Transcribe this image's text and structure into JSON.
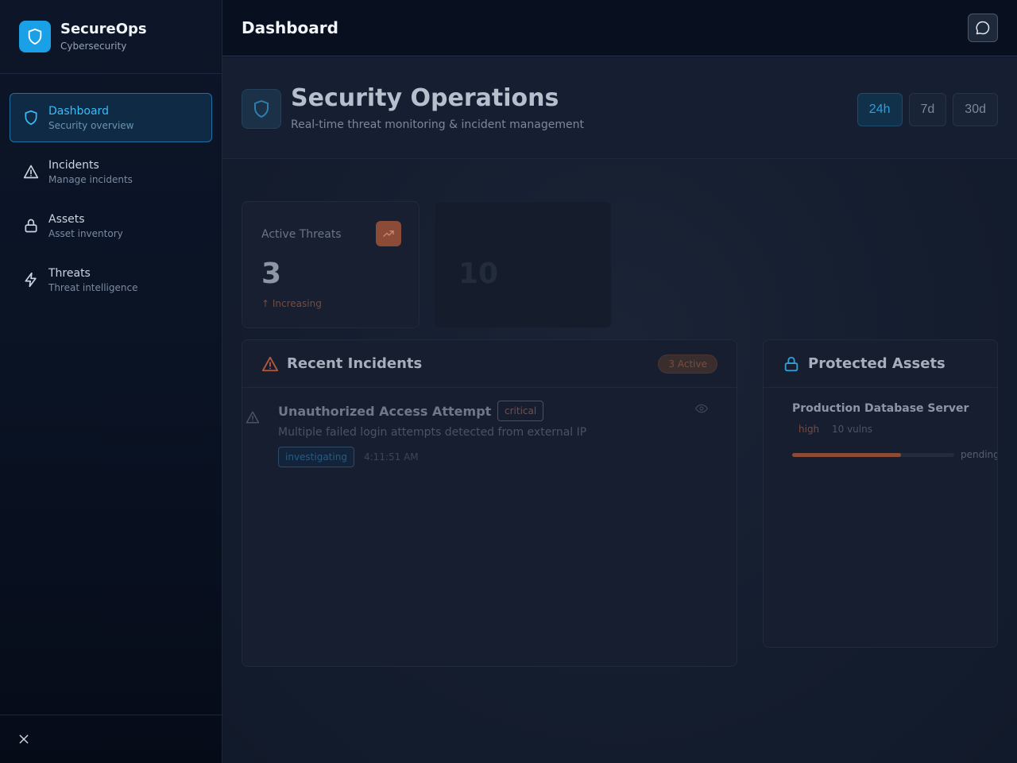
{
  "brand": {
    "name": "SecureOps",
    "subtitle": "Cybersecurity",
    "accent": "#1aa0e6"
  },
  "sidebar": {
    "items": [
      {
        "label": "Dashboard",
        "description": "Security overview",
        "icon": "shield-icon",
        "active": true
      },
      {
        "label": "Incidents",
        "description": "Manage incidents",
        "icon": "alert-triangle-icon",
        "active": false
      },
      {
        "label": "Assets",
        "description": "Asset inventory",
        "icon": "lock-icon",
        "active": false
      },
      {
        "label": "Threats",
        "description": "Threat intelligence",
        "icon": "zap-icon",
        "active": false
      }
    ],
    "footer_icon": "close-icon"
  },
  "topbar": {
    "title": "Dashboard",
    "chat_icon": "chat-icon"
  },
  "main": {
    "header": {
      "title": "Security Operations",
      "subtitle": "Real-time threat monitoring & incident management"
    },
    "ranges": [
      {
        "label": "24h",
        "active": true
      },
      {
        "label": "7d",
        "active": false
      },
      {
        "label": "30d",
        "active": false
      }
    ],
    "stats": [
      {
        "label": "Active Threats",
        "value": "3",
        "trend": "↑ Increasing",
        "icon": "trending-up-icon"
      },
      {
        "label": "",
        "value": "10",
        "trend": "",
        "icon": ""
      }
    ],
    "incidents_panel": {
      "title": "Recent Incidents",
      "active_badge": "3 Active",
      "items": [
        {
          "title": "Unauthorized Access Attempt",
          "severity": "critical",
          "description": "Multiple failed login attempts detected from external IP",
          "status": "investigating",
          "time": "4:11:51 AM"
        }
      ]
    },
    "assets_panel": {
      "title": "Protected Assets",
      "items": [
        {
          "name": "Production Database Server",
          "criticality": "high",
          "vulns": "10 vulns",
          "progress": 0.67,
          "status": "pending"
        }
      ]
    }
  },
  "colors": {
    "danger": "#8c4b37",
    "info": "#2f9fd8"
  }
}
